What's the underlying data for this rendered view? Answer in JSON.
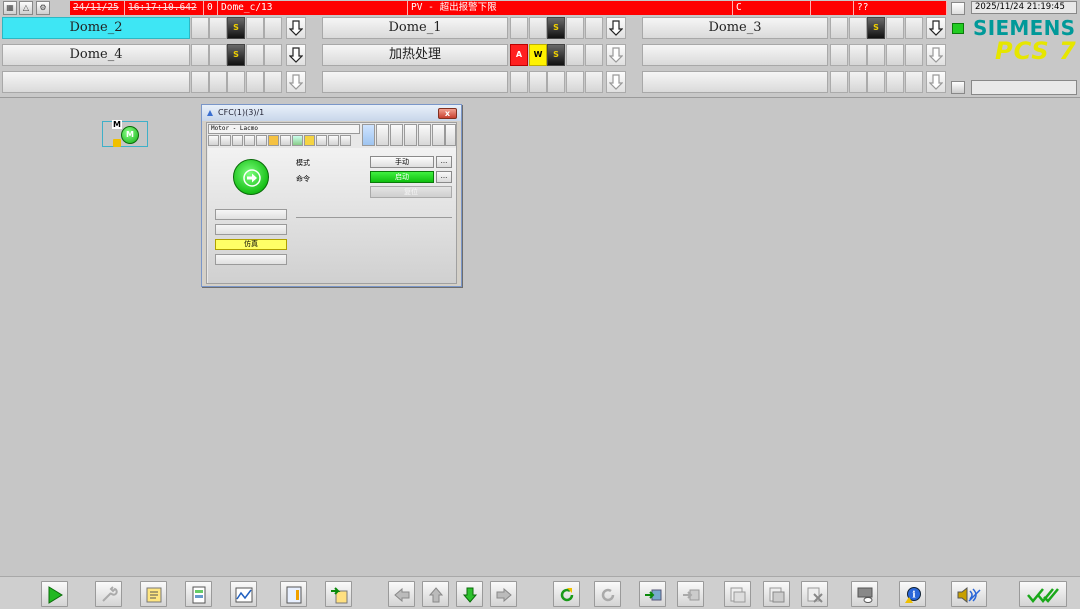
{
  "alarm_line": {
    "date": "24/11/25",
    "time": "16:17:10.642",
    "count": "0",
    "source": "Dome_c/13",
    "message": "PV - 超出报警下限",
    "unit_col": "C",
    "value_col": "??"
  },
  "clock": "2025/11/24 21:19:45",
  "brand": {
    "siemens": "SIEMENS",
    "product": "PCS 7",
    "teal": "#009999",
    "yellow": "#e6e600"
  },
  "areas": [
    {
      "label": "Dome_2",
      "active": true
    },
    {
      "label": "Dome_1",
      "active": false
    },
    {
      "label": "Dome_3",
      "active": false
    },
    {
      "label": "Dome_4",
      "active": false
    },
    {
      "label": "加热处理",
      "active": false
    }
  ],
  "status_cells": {
    "dome_2": "S",
    "dome_1": "S",
    "dome_3": "S",
    "dome_4": "S",
    "heat_a": "A",
    "heat_w": "W",
    "heat_s": "S"
  },
  "workspace": {
    "motor_symbol": {
      "badge": "M",
      "circle": "M"
    }
  },
  "faceplate": {
    "title": "CFC(1)(3)/1",
    "tag": "Motor - Lacmo",
    "close_label": "x",
    "mode_label": "模式",
    "command_label": "命令",
    "mode_value": "手动",
    "command_value": "启动",
    "reset_label": "复位",
    "dots": "...",
    "simulation_label": "仿真"
  },
  "icons": {
    "top": [
      "overview-icon",
      "alarm-icon",
      "options-icon"
    ],
    "bottom": [
      "start-icon",
      "tools-icon",
      "report-icon",
      "batch-icon",
      "trend-icon",
      "process-icon",
      "export-icon",
      "nav-left-icon",
      "nav-up-icon",
      "nav-down-icon",
      "nav-right-icon",
      "refresh-icon",
      "redo-icon",
      "step-icon",
      "forward-icon",
      "print-icon",
      "copy-icon",
      "close-icon",
      "screen-icon",
      "info-icon",
      "audio-icon",
      "acknowledge-icon"
    ]
  }
}
